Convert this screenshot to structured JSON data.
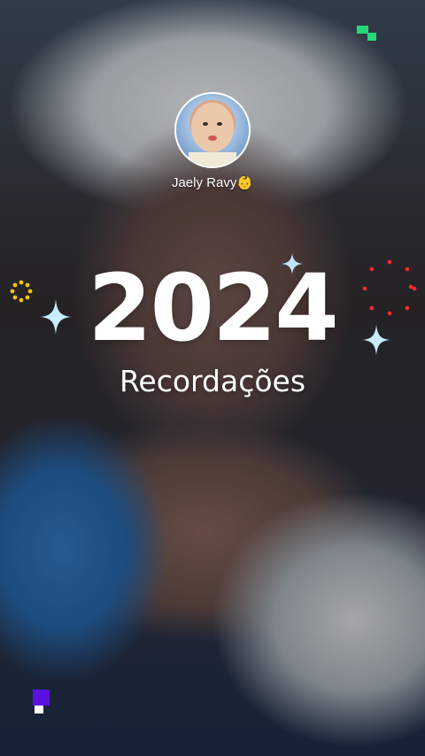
{
  "profile": {
    "name": "Jaely Ravy👶"
  },
  "title": {
    "year": "2024",
    "subtitle": "Recordações"
  },
  "colors": {
    "text": "#ffffff",
    "glitch_green": "#25d979",
    "glitch_purple": "#5a11e0",
    "red_dots": "#ff2a2a",
    "yellow_ring": "#f2c21a",
    "sparkle": "#bfe6ff"
  },
  "icons": [
    "sparkle-icon",
    "red-dots-ring-icon",
    "yellow-dots-ring-icon",
    "glitch-logo-icon"
  ]
}
